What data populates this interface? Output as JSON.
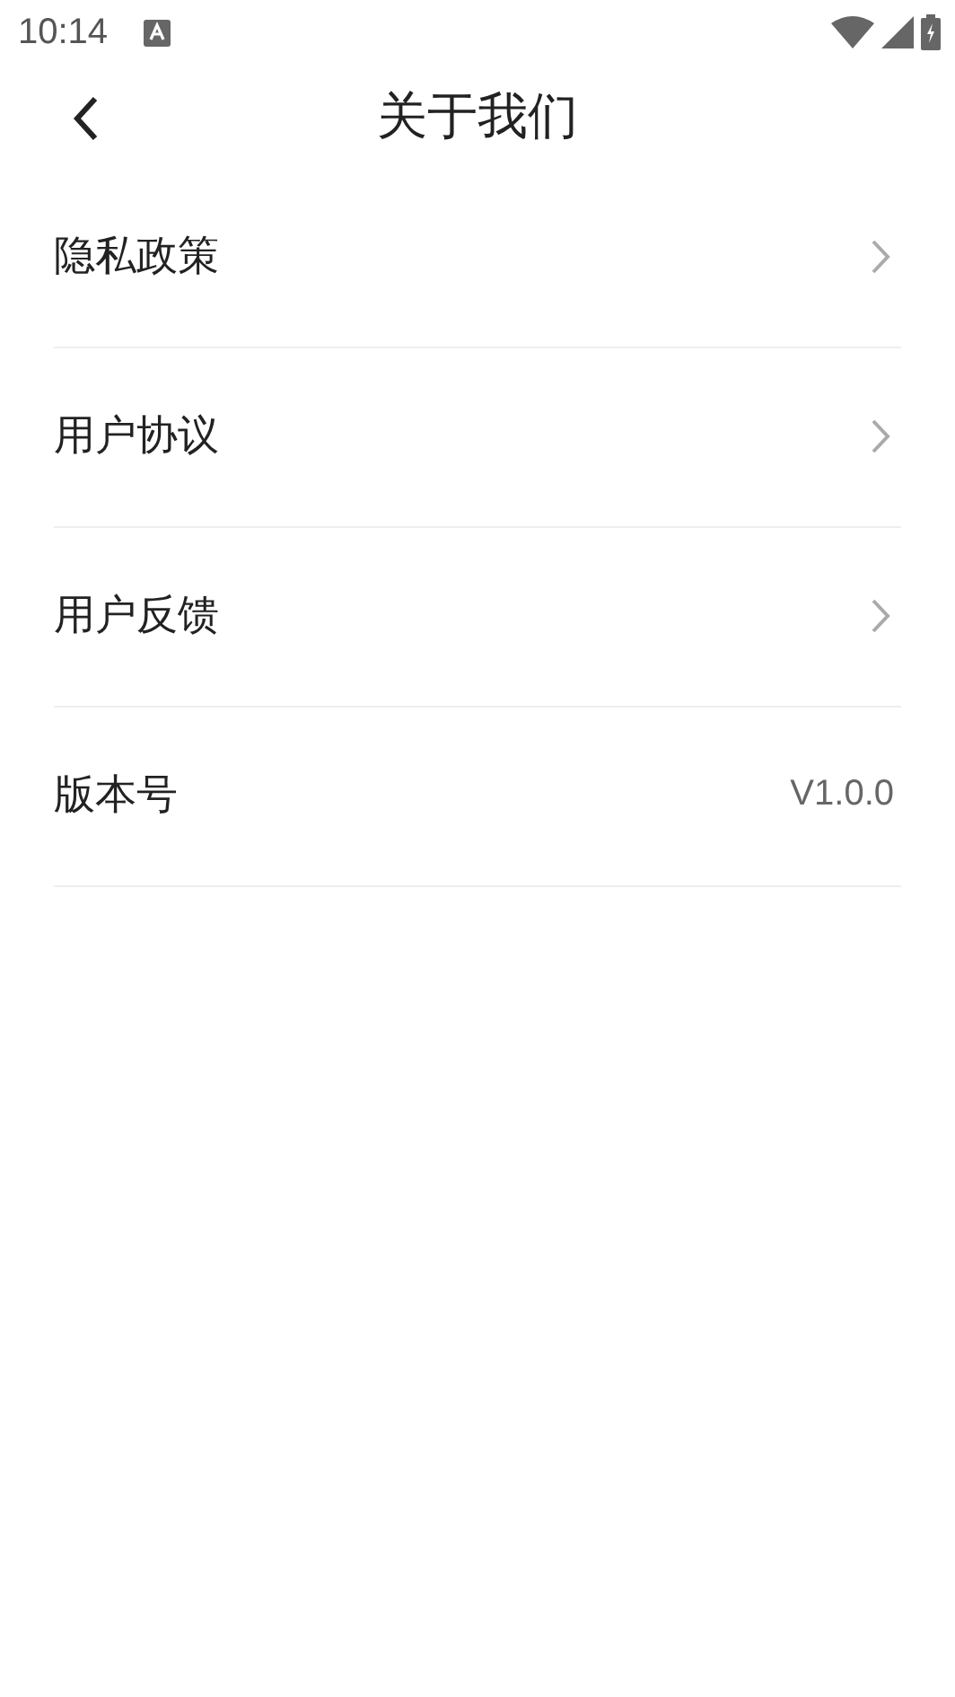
{
  "status_bar": {
    "time": "10:14"
  },
  "header": {
    "title": "关于我们"
  },
  "items": [
    {
      "kind": "link",
      "label": "隐私政策"
    },
    {
      "kind": "link",
      "label": "用户协议"
    },
    {
      "kind": "link",
      "label": "用户反馈"
    },
    {
      "kind": "info",
      "label": "版本号",
      "value": "V1.0.0"
    }
  ]
}
